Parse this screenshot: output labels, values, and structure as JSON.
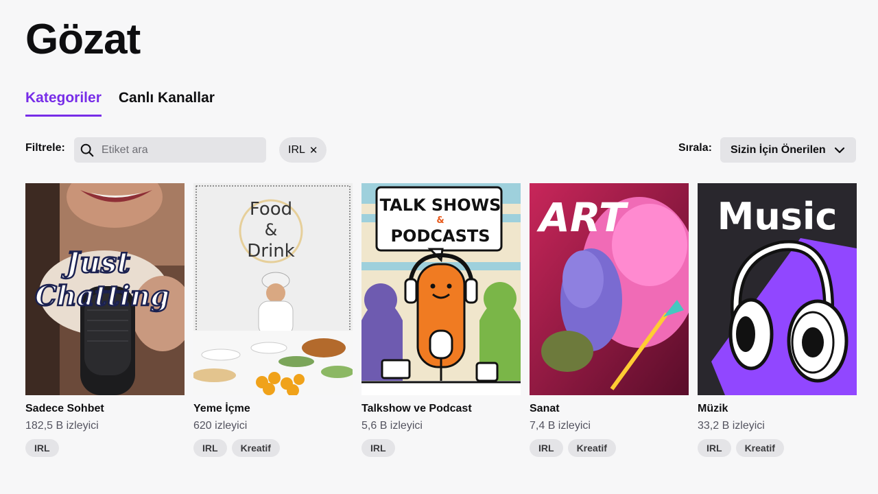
{
  "page": {
    "title": "Gözat"
  },
  "tabs": [
    {
      "label": "Kategoriler",
      "active": true
    },
    {
      "label": "Canlı Kanallar",
      "active": false
    }
  ],
  "filter": {
    "label": "Filtrele:",
    "search_placeholder": "Etiket ara",
    "active_tag": "IRL",
    "remove_icon": "close-icon"
  },
  "sort": {
    "label": "Sırala:",
    "selected": "Sizin İçin Önerilen",
    "icon": "chevron-down-icon"
  },
  "colors": {
    "accent": "#772ce8",
    "background": "#f7f7f8",
    "chip": "#e4e4e7",
    "muted_text": "#53535f"
  },
  "categories": [
    {
      "title": "Sadece Sohbet",
      "viewers": "182,5 B izleyici",
      "tags": [
        "IRL"
      ],
      "art_text": [
        "Just",
        "Chatting"
      ]
    },
    {
      "title": "Yeme İçme",
      "viewers": "620 izleyici",
      "tags": [
        "IRL",
        "Kreatif"
      ],
      "art_text": [
        "Food",
        "&",
        "Drink"
      ]
    },
    {
      "title": "Talkshow ve Podcast",
      "viewers": "5,6 B izleyici",
      "tags": [
        "IRL"
      ],
      "art_text": [
        "TALK SHOWS",
        "&",
        "PODCASTS"
      ]
    },
    {
      "title": "Sanat",
      "viewers": "7,4 B izleyici",
      "tags": [
        "IRL",
        "Kreatif"
      ],
      "art_text": [
        "ART"
      ]
    },
    {
      "title": "Müzik",
      "viewers": "33,2 B izleyici",
      "tags": [
        "IRL",
        "Kreatif"
      ],
      "art_text": [
        "Music"
      ]
    }
  ]
}
